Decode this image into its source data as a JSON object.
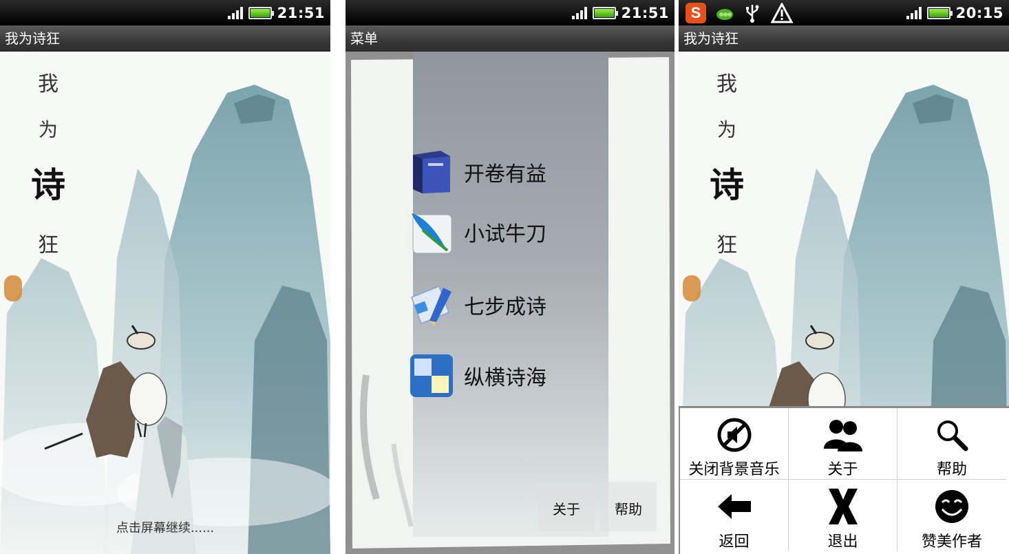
{
  "screens": [
    {
      "status": {
        "time": "21:51"
      },
      "app_title": "我为诗狂",
      "splash": {
        "title_chars": [
          "我",
          "为",
          "诗",
          "狂"
        ],
        "hint": "点击屏幕继续......"
      }
    },
    {
      "status": {
        "time": "21:51"
      },
      "app_title": "菜单",
      "menu": {
        "items": [
          {
            "label": "开卷有益",
            "icon": "book-icon"
          },
          {
            "label": "小试牛刀",
            "icon": "feather-icon"
          },
          {
            "label": "七步成诗",
            "icon": "pencil-paper-icon"
          },
          {
            "label": "纵横诗海",
            "icon": "checker-grid-icon"
          }
        ],
        "about_label": "关于",
        "help_label": "帮助"
      }
    },
    {
      "status": {
        "time": "20:15",
        "notification_icons": [
          "sogou-icon",
          "pea-icon",
          "usb-icon",
          "warning-icon"
        ]
      },
      "app_title": "我为诗狂",
      "splash": {
        "title_chars": [
          "我",
          "为",
          "诗",
          "狂"
        ]
      },
      "options_menu": [
        {
          "label": "关闭背景音乐",
          "icon": "mute-icon"
        },
        {
          "label": "关于",
          "icon": "people-icon"
        },
        {
          "label": "帮助",
          "icon": "magnifier-icon"
        },
        {
          "label": "返回",
          "icon": "back-arrow-icon"
        },
        {
          "label": "退出",
          "icon": "x-exit-icon"
        },
        {
          "label": "赞美作者",
          "icon": "smiley-icon"
        }
      ]
    }
  ],
  "colors": {
    "titlebar": "#3a3a3a",
    "menu_panel": "#a6adb3",
    "ink_wash": "#6f9aa6",
    "battery_green": "#3aa10e"
  }
}
